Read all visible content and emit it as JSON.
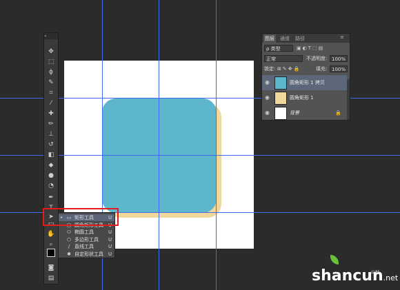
{
  "canvas": {
    "background": "#ffffff",
    "shape_fill": "#5eb6cc",
    "shape_shadow": "#f1d79a",
    "guide_color": "#3d6cf0"
  },
  "toolbox": {
    "collapse_glyph": "«",
    "tools": [
      {
        "name": "move-tool",
        "icon": "✥"
      },
      {
        "name": "marquee-tool",
        "icon": "⬚"
      },
      {
        "name": "lasso-tool",
        "icon": "ϕ"
      },
      {
        "name": "quick-select-tool",
        "icon": "✎"
      },
      {
        "name": "crop-tool",
        "icon": "⌗"
      },
      {
        "name": "eyedropper-tool",
        "icon": "⁄"
      },
      {
        "name": "healing-brush-tool",
        "icon": "✚"
      },
      {
        "name": "brush-tool",
        "icon": "✏"
      },
      {
        "name": "clone-stamp-tool",
        "icon": "⊥"
      },
      {
        "name": "history-brush-tool",
        "icon": "↺"
      },
      {
        "name": "eraser-tool",
        "icon": "◧"
      },
      {
        "name": "paint-bucket-tool",
        "icon": "◆"
      },
      {
        "name": "blur-tool",
        "icon": "●"
      },
      {
        "name": "dodge-tool",
        "icon": "◔"
      },
      {
        "name": "pen-tool",
        "icon": "✒"
      },
      {
        "name": "type-tool",
        "icon": "T"
      },
      {
        "name": "path-select-tool",
        "icon": "➤"
      },
      {
        "name": "shape-tool",
        "icon": "▭"
      },
      {
        "name": "hand-tool",
        "icon": "✋"
      },
      {
        "name": "zoom-tool",
        "icon": "⌕"
      }
    ]
  },
  "flyout": {
    "items": [
      {
        "label": "矩形工具",
        "key": "U",
        "icon": "▭",
        "selected": true
      },
      {
        "label": "圆角矩形工具",
        "key": "U",
        "icon": "▢",
        "selected": false
      },
      {
        "label": "椭圆工具",
        "key": "U",
        "icon": "⬭",
        "selected": false
      },
      {
        "label": "多边形工具",
        "key": "U",
        "icon": "⬡",
        "selected": false
      },
      {
        "label": "直线工具",
        "key": "U",
        "icon": "∕",
        "selected": false
      },
      {
        "label": "自定形状工具",
        "key": "U",
        "icon": "✱",
        "selected": false
      }
    ]
  },
  "layers_panel": {
    "tabs": [
      "图层",
      "通道",
      "路径"
    ],
    "filter_label": "ρ 类型",
    "blend_mode": "正常",
    "opacity_label": "不透明度:",
    "opacity_value": "100%",
    "lock_label": "锁定:",
    "fill_label": "填充:",
    "fill_value": "100%",
    "layers": [
      {
        "name": "圆角矩形 1 拷贝",
        "selected": true,
        "italic": false
      },
      {
        "name": "圆角矩形 1",
        "selected": false,
        "italic": false
      },
      {
        "name": "背景",
        "selected": false,
        "italic": true
      }
    ]
  },
  "watermark": {
    "text": "shancun",
    "domain": ".net",
    "sub": "山村"
  }
}
